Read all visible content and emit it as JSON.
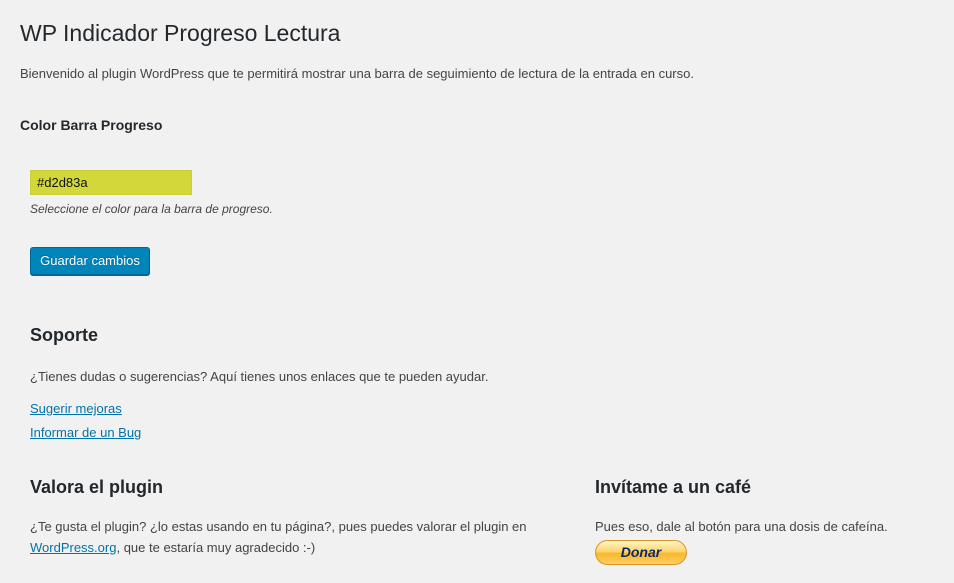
{
  "page": {
    "title": "WP Indicador Progreso Lectura",
    "intro": "Bienvenido al plugin WordPress que te permitirá mostrar una barra de seguimiento de lectura de la entrada en curso."
  },
  "settings": {
    "color_label": "Color Barra Progreso",
    "color_value": "#d2d83a",
    "color_swatch": "#d2d83a",
    "color_description": "Seleccione el color para la barra de progreso.",
    "save_label": "Guardar cambios"
  },
  "support": {
    "heading": "Soporte",
    "text": "¿Tienes dudas o sugerencias? Aquí tienes unos enlaces que te pueden ayudar.",
    "links": [
      {
        "label": "Sugerir mejoras"
      },
      {
        "label": "Informar de un Bug"
      }
    ]
  },
  "rate": {
    "heading": "Valora el plugin",
    "text_before": "¿Te gusta el plugin? ¿lo estas usando en tu página?, pues puedes valorar el plugin en",
    "link_label": "WordPress.org",
    "text_after": ", que te estaría muy agradecido :-)"
  },
  "coffee": {
    "heading": "Invítame a un café",
    "text": "Pues eso, dale al botón para una dosis de cafeína.",
    "donate_label": "Donar"
  },
  "colors": {
    "background": "#f1f1f1",
    "primary_button": "#0085ba",
    "link": "#0073aa",
    "donate_gold": "#ffc439"
  }
}
